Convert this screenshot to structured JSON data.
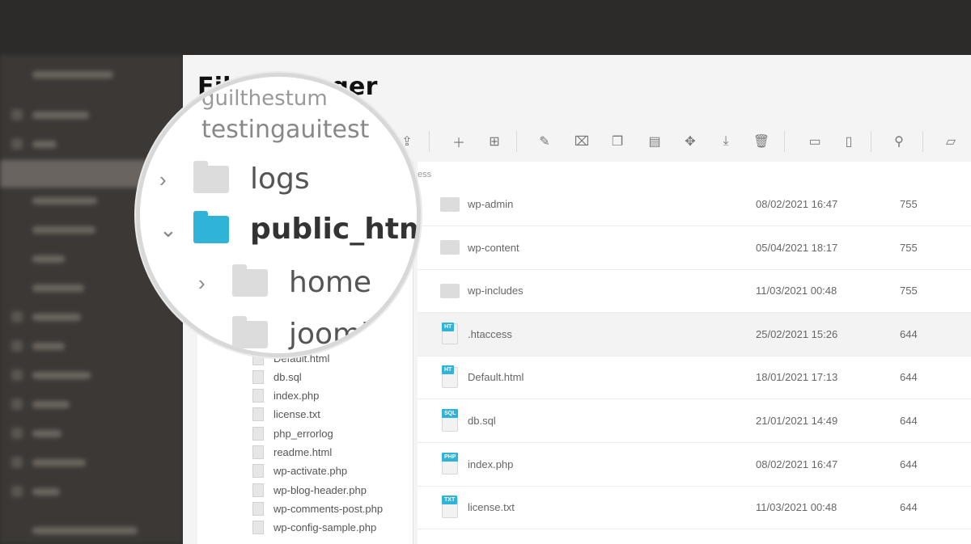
{
  "app": {
    "title": "File Manager"
  },
  "magnifier": {
    "top_partial_1": "guilthestum",
    "top_partial_2": "testingauitest",
    "items": [
      {
        "label": "logs",
        "expanded": false,
        "folder_color": "#dcdcdc",
        "bold": false
      },
      {
        "label": "public_html",
        "expanded": true,
        "folder_color": "#2fb3d6",
        "bold": true
      },
      {
        "label": "home",
        "expanded": false,
        "folder_color": "#dcdcdc",
        "bold": false
      },
      {
        "label": "joomla",
        "expanded": false,
        "folder_color": "#dcdcdc",
        "bold": false
      }
    ]
  },
  "toolbar": {
    "icons": [
      "folder-upload-icon",
      "new-file-icon",
      "new-folder-icon",
      "edit-icon",
      "rename-icon",
      "copy-icon",
      "paste-icon",
      "move-icon",
      "download-icon",
      "delete-icon",
      "archive-icon",
      "extract-icon",
      "permissions-icon",
      "folder-icon"
    ]
  },
  "list_header": {
    "partial": "ess"
  },
  "tree_files": [
    "Default.html",
    "db.sql",
    "index.php",
    "license.txt",
    "php_errorlog",
    "readme.html",
    "wp-activate.php",
    "wp-blog-header.php",
    "wp-comments-post.php",
    "wp-config-sample.php"
  ],
  "files": [
    {
      "name": "wp-admin",
      "date": "08/02/2021 16:47",
      "perm": "755",
      "type": "folder"
    },
    {
      "name": "wp-content",
      "date": "05/04/2021 18:17",
      "perm": "755",
      "type": "folder"
    },
    {
      "name": "wp-includes",
      "date": "11/03/2021 00:48",
      "perm": "755",
      "type": "folder"
    },
    {
      "name": ".htaccess",
      "date": "25/02/2021 15:26",
      "perm": "644",
      "type": "file",
      "badge": "HT",
      "badge_color": "#2fb3d6",
      "highlight": true
    },
    {
      "name": "Default.html",
      "date": "18/01/2021 17:13",
      "perm": "644",
      "type": "file",
      "badge": "HT",
      "badge_color": "#2fb3d6"
    },
    {
      "name": "db.sql",
      "date": "21/01/2021 14:49",
      "perm": "644",
      "type": "file",
      "badge": "SQL",
      "badge_color": "#2fb3d6"
    },
    {
      "name": "index.php",
      "date": "08/02/2021 16:47",
      "perm": "644",
      "type": "file",
      "badge": "PHP",
      "badge_color": "#2fb3d6"
    },
    {
      "name": "license.txt",
      "date": "11/03/2021 00:48",
      "perm": "644",
      "type": "file",
      "badge": "TXT",
      "badge_color": "#2fb3d6"
    }
  ]
}
